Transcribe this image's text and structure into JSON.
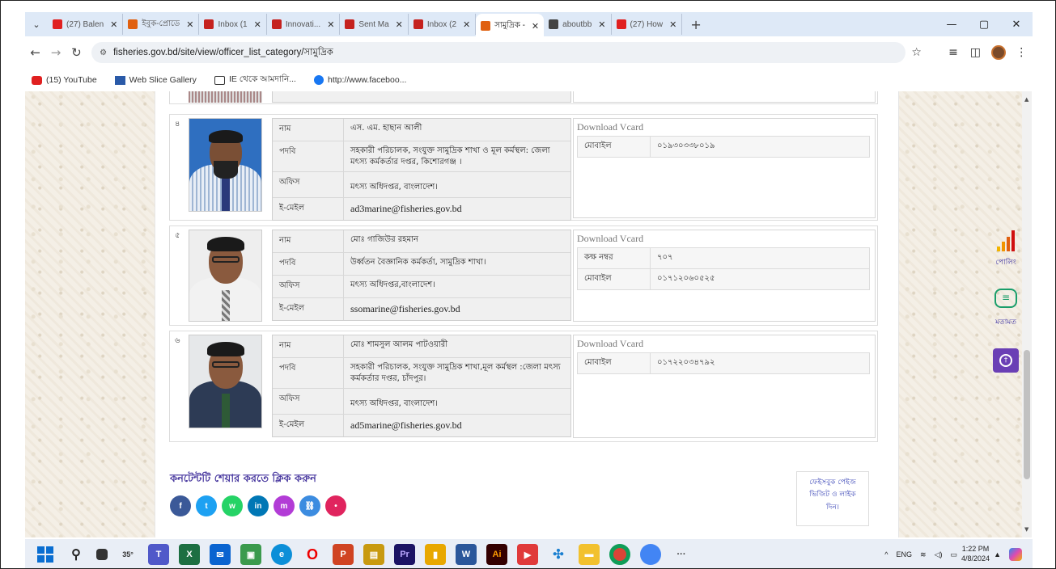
{
  "browser": {
    "tabs": [
      {
        "label": "(27) Balen",
        "color": "#e02020"
      },
      {
        "label": "ইবুক-প্রোডে",
        "color": "#e06010"
      },
      {
        "label": "Inbox (1",
        "color": "#c5221f"
      },
      {
        "label": "Innovati...",
        "color": "#c5221f"
      },
      {
        "label": "Sent Ma",
        "color": "#c5221f"
      },
      {
        "label": "Inbox (2",
        "color": "#c5221f"
      },
      {
        "label": "সামুদ্রিক -",
        "color": "#e06010",
        "active": true
      },
      {
        "label": "aboutbb",
        "color": "#444444"
      },
      {
        "label": "(27) How",
        "color": "#e02020"
      }
    ],
    "url": "fisheries.gov.bd/site/view/officer_list_category/সামুদ্রিক",
    "bookmarks": [
      "(15) YouTube",
      "Web Slice Gallery",
      "IE থেকে আমদানি...",
      "http://www.faceboo..."
    ]
  },
  "officers": [
    {
      "num": "৪",
      "rows": [
        {
          "k": "নাম",
          "v": "এস. এম. হাছান আলী"
        },
        {
          "k": "পদবি",
          "v": "সহকারী পরিচালক, সংযুক্ত সামুদ্রিক শাখা ও মূল কর্মস্থল: জেলা মৎস্য কর্মকর্তার দপ্তর, কিশোরগঞ্জ ।"
        },
        {
          "k": "অফিস",
          "v": "মৎস্য অধিদপ্তর, বাংলাদেশ।"
        },
        {
          "k": "ই-মেইল",
          "v": "ad3marine@fisheries.gov.bd"
        }
      ],
      "vcard": [
        {
          "k": "মোবাইল",
          "v": "০১৯৩০৩৩৮০১৯"
        }
      ]
    },
    {
      "num": "৫",
      "rows": [
        {
          "k": "নাম",
          "v": "মোঃ গাজিউর রহমান"
        },
        {
          "k": "পদবি",
          "v": "উর্ধ্বতন বৈজ্ঞানিক কর্মকর্তা, সামুদ্রিক শাখা।"
        },
        {
          "k": "অফিস",
          "v": "মৎস্য অধিদপ্তর,বাংলাদেশ।"
        },
        {
          "k": "ই-মেইল",
          "v": "ssomarine@fisheries.gov.bd"
        }
      ],
      "vcard": [
        {
          "k": "কক্ষ নম্বর",
          "v": "৭০৭"
        },
        {
          "k": "মোবাইল",
          "v": "০১৭১২০৬০৫২৫"
        }
      ]
    },
    {
      "num": "৬",
      "rows": [
        {
          "k": "নাম",
          "v": "মোঃ শামসুল আলম পাটওয়ারী"
        },
        {
          "k": "পদবি",
          "v": "সহকারী পরিচালক, সংযুক্ত সামুদ্রিক শাখা,মূল কর্মস্থল :জেলা মৎস্য কর্মকর্তার দপ্তর, চাঁদপুর।"
        },
        {
          "k": "অফিস",
          "v": "মৎস্য অধিদপ্তর, বাংলাদেশ।"
        },
        {
          "k": "ই-মেইল",
          "v": "ad5marine@fisheries.gov.bd"
        }
      ],
      "vcard": [
        {
          "k": "মোবাইল",
          "v": "০১৭২২০৩৪৭৯২"
        }
      ]
    }
  ],
  "vcard_label": "Download Vcard",
  "share": {
    "title": "কনটেন্টটি শেয়ার করতে ক্লিক করুন"
  },
  "facebook_box": {
    "line1": "ফেইসবুক পেইজ",
    "line2": "ভিজিট ও লাইক",
    "line3": "দিন।"
  },
  "widgets": {
    "poll": "পোলিং",
    "feedback": "মতামত"
  },
  "tray": {
    "lang": "ENG",
    "time": "1:22 PM",
    "date": "4/8/2024",
    "weather": "35°"
  }
}
